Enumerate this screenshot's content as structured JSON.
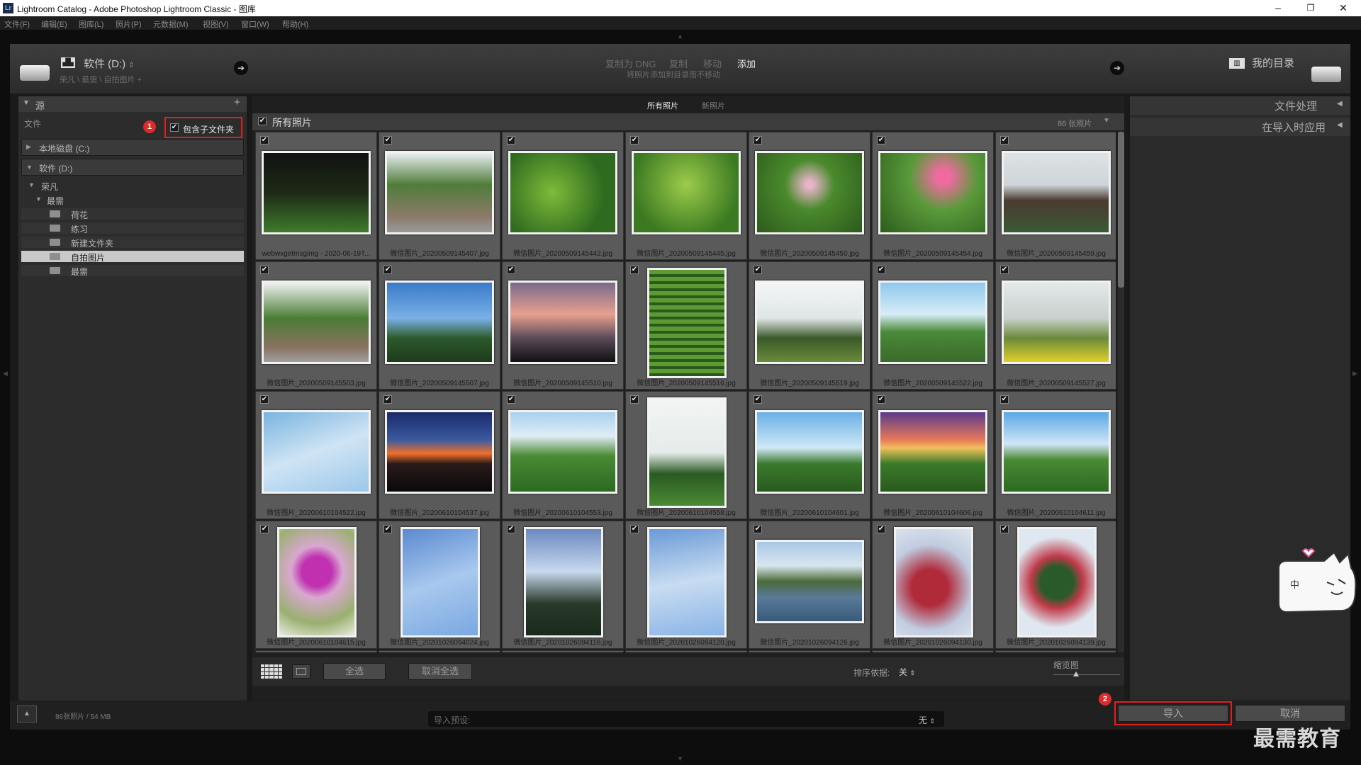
{
  "window": {
    "app_icon": "Lr",
    "title": "Lightroom Catalog - Adobe Photoshop Lightroom Classic - 图库"
  },
  "menu": [
    "文件(F)",
    "编辑(E)",
    "图库(L)",
    "照片(P)",
    "元数据(M)",
    "视图(V)",
    "窗口(W)",
    "帮助(H)"
  ],
  "header": {
    "source_drive": "软件 (D:)",
    "source_path": "荣凡 \\ 最需 \\ 自拍图片 +",
    "modes": [
      "复制为 DNG",
      "复制",
      "移动",
      "添加"
    ],
    "active_mode": "添加",
    "mode_description": "将照片添加到目录而不移动",
    "destination": "我的目录"
  },
  "left_panel": {
    "title": "源",
    "files_label": "文件",
    "include_subfolders": "包含子文件夹",
    "tree": [
      {
        "label": "本地磁盘 (C:)",
        "type": "drive"
      },
      {
        "label": "软件 (D:)",
        "type": "drive"
      },
      {
        "label": "荣凡",
        "type": "folder"
      },
      {
        "label": "最需",
        "type": "folder"
      },
      {
        "label": "荷花",
        "type": "folder"
      },
      {
        "label": "练习",
        "type": "folder"
      },
      {
        "label": "新建文件夹",
        "type": "folder"
      },
      {
        "label": "自拍图片",
        "type": "folder",
        "selected": true
      },
      {
        "label": "最需",
        "type": "folder"
      }
    ]
  },
  "grid": {
    "tabs": [
      "所有照片",
      "新照片"
    ],
    "all_photos_label": "所有照片",
    "count": "86 张照片",
    "photos": [
      "webwxgetmsgimg - 2020-06-19T...",
      "微信图片_20200509145407.jpg",
      "微信图片_20200509145442.jpg",
      "微信图片_20200509145445.jpg",
      "微信图片_20200509145450.jpg",
      "微信图片_20200509145454.jpg",
      "微信图片_20200509145459.jpg",
      "微信图片_20200509145503.jpg",
      "微信图片_20200509145507.jpg",
      "微信图片_20200509145510.jpg",
      "微信图片_20200509145516.jpg",
      "微信图片_20200509145519.jpg",
      "微信图片_20200509145522.jpg",
      "微信图片_20200509145527.jpg",
      "微信图片_20200610104522.jpg",
      "微信图片_20200610104537.jpg",
      "微信图片_20200610104553.jpg",
      "微信图片_20200610104558.jpg",
      "微信图片_20200610104601.jpg",
      "微信图片_20200610104606.jpg",
      "微信图片_20200610104611.jpg",
      "微信图片_20200610104615.jpg",
      "微信图片_20201026094024.jpg",
      "微信图片_20201026094116.jpg",
      "微信图片_20201026094120.jpg",
      "微信图片_20201026094126.jpg",
      "微信图片_20201026094130.jpg",
      "微信图片_20201026094139.jpg"
    ]
  },
  "toolbar": {
    "select_all": "全选",
    "deselect_all": "取消全选",
    "sort_label": "排序依据:",
    "sort_value": "关",
    "thumbnail_label": "缩览图"
  },
  "right_panel": {
    "file_handling": "文件处理",
    "apply_during_import": "在导入时应用"
  },
  "footer": {
    "summary": "86张照片 / 54 MB",
    "preset_label": "导入预设:",
    "preset_value": "无",
    "import": "导入",
    "cancel": "取消"
  },
  "badges": {
    "one": "1",
    "two": "2"
  },
  "watermark": "最需教育",
  "colors": {
    "highlight": "#e0201f",
    "badge": "#dd2a2a",
    "cell": "#5a5a5a"
  }
}
